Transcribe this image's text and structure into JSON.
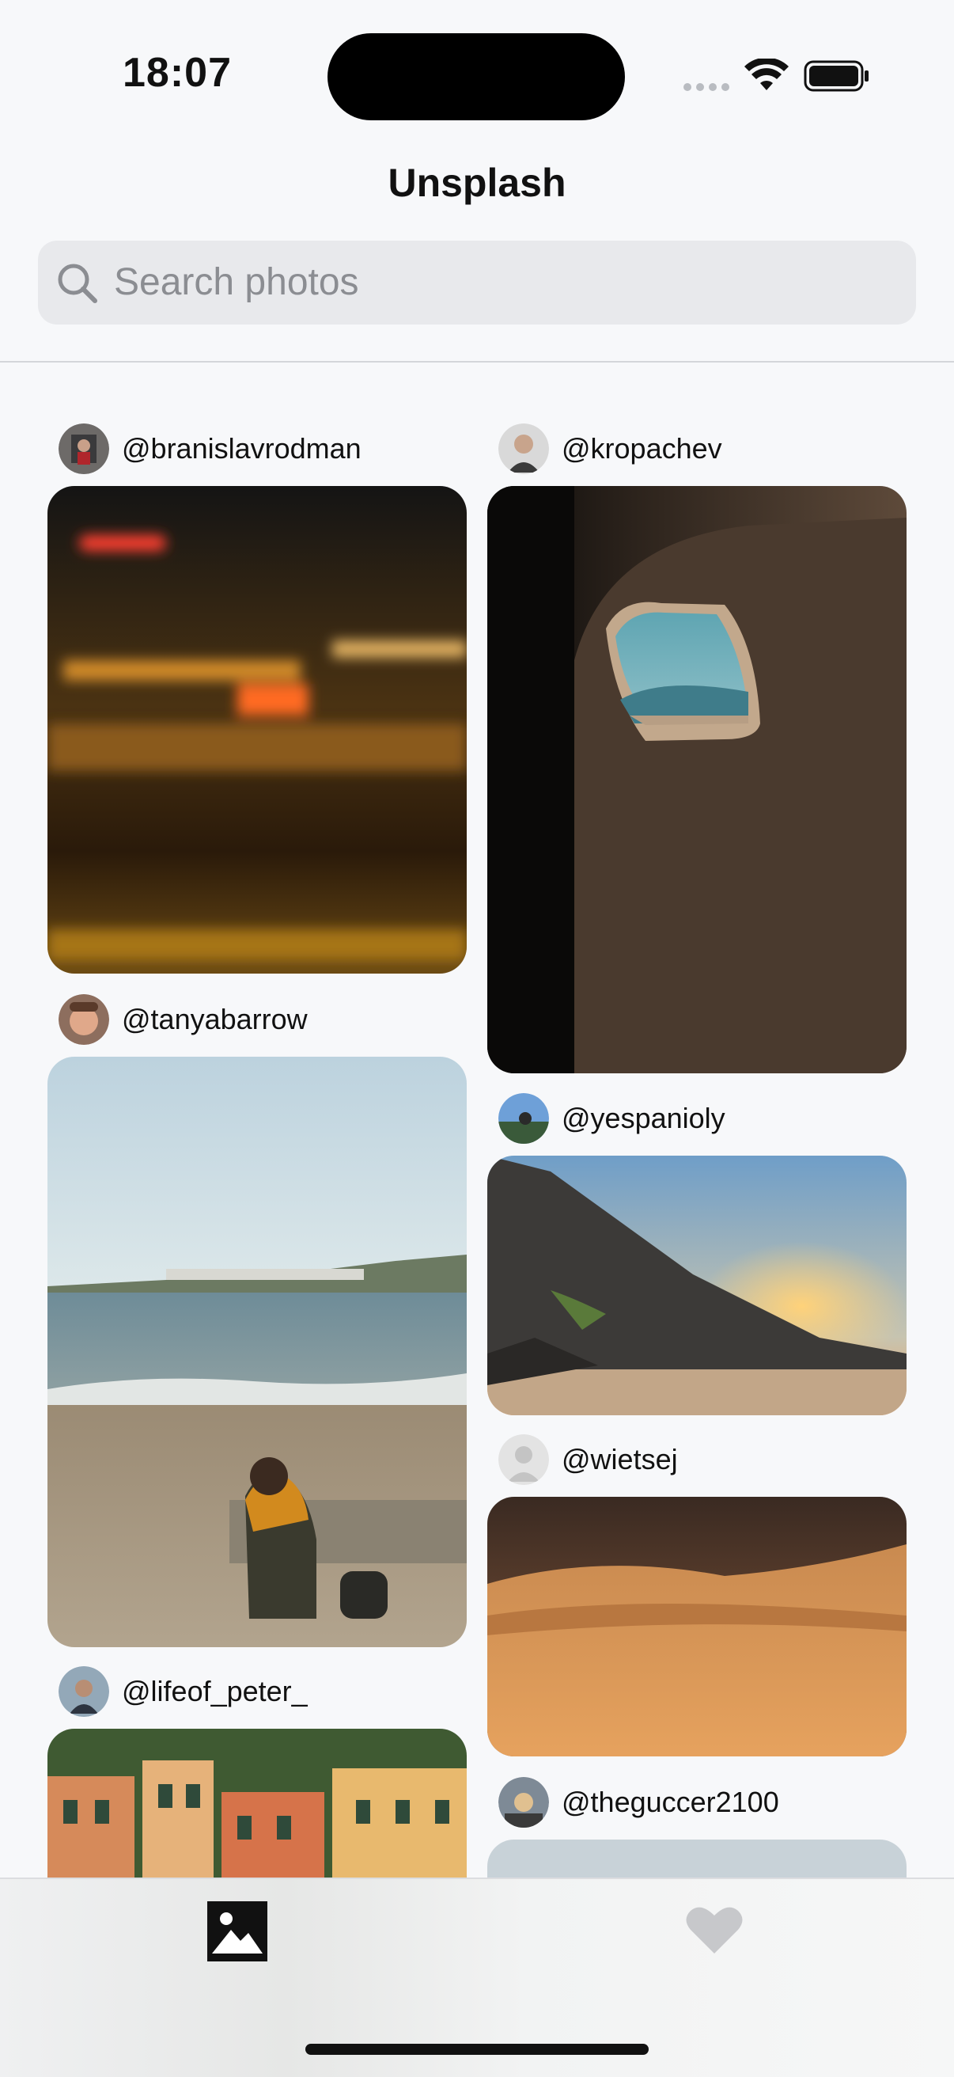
{
  "status_bar": {
    "time": "18:07"
  },
  "header": {
    "title": "Unsplash"
  },
  "search": {
    "placeholder": "Search photos"
  },
  "feed": {
    "left_column": [
      {
        "username": "@branislavrodman"
      },
      {
        "username": "@tanyabarrow"
      },
      {
        "username": "@lifeof_peter_"
      }
    ],
    "right_column": [
      {
        "username": "@kropachev"
      },
      {
        "username": "@yespanioly"
      },
      {
        "username": "@wietsej"
      },
      {
        "username": "@theguccer2100"
      }
    ]
  },
  "tab_bar": {
    "tabs": [
      {
        "icon": "photo-icon",
        "selected": true
      },
      {
        "icon": "heart-icon",
        "selected": false
      }
    ]
  },
  "colors": {
    "background": "#f7f8fa",
    "search_field": "#e8e9ec",
    "inactive_tab": "#c7c8cb"
  }
}
